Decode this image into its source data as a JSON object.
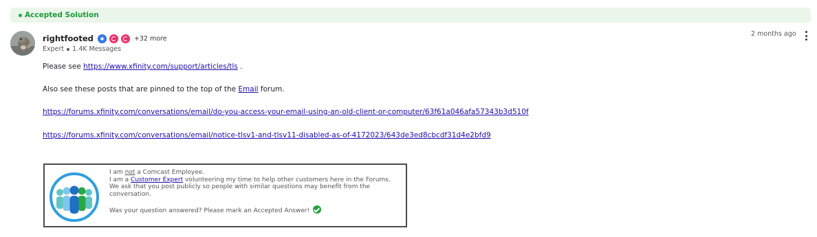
{
  "accepted_label": "Accepted Solution",
  "author": {
    "name": "rightfooted",
    "more_badges": "+32 more",
    "rank": "Expert",
    "messages": "1.4K Messages"
  },
  "timestamp": "2 months ago",
  "body": {
    "p1_prefix": "Please see ",
    "p1_link": "https://www.xfinity.com/support/articles/tls",
    "p1_suffix": " .",
    "p2_prefix": "Also see these posts that are pinned to the top of the ",
    "p2_link": "Email",
    "p2_suffix": " forum.",
    "link1": "https://forums.xfinity.com/conversations/email/do-you-access-your-email-using-an-old-client-or-computer/63f61a046afa57343b3d510f",
    "link2": "https://forums.xfinity.com/conversations/email/notice-tlsv1-and-tlsv11-disabled-as-of-4172023/643de3ed8cbcdf31d4e2bfd9"
  },
  "signature": {
    "l1_a": "I am ",
    "l1_not": "not",
    "l1_b": " a Comcast Employee.",
    "l2_a": "I am a ",
    "l2_link": "Customer Expert",
    "l2_b": " volunteering my time to help other customers here in the Forums.",
    "l3": "We ask that you post publicly so people with similar questions may benefit from the conversation.",
    "l4": "Was your question answered? Please mark an Accepted Answer!"
  },
  "colors": {
    "accent_green": "#1e9a3a",
    "link": "#1a0dab",
    "logo_blue": "#2f9ee0"
  }
}
